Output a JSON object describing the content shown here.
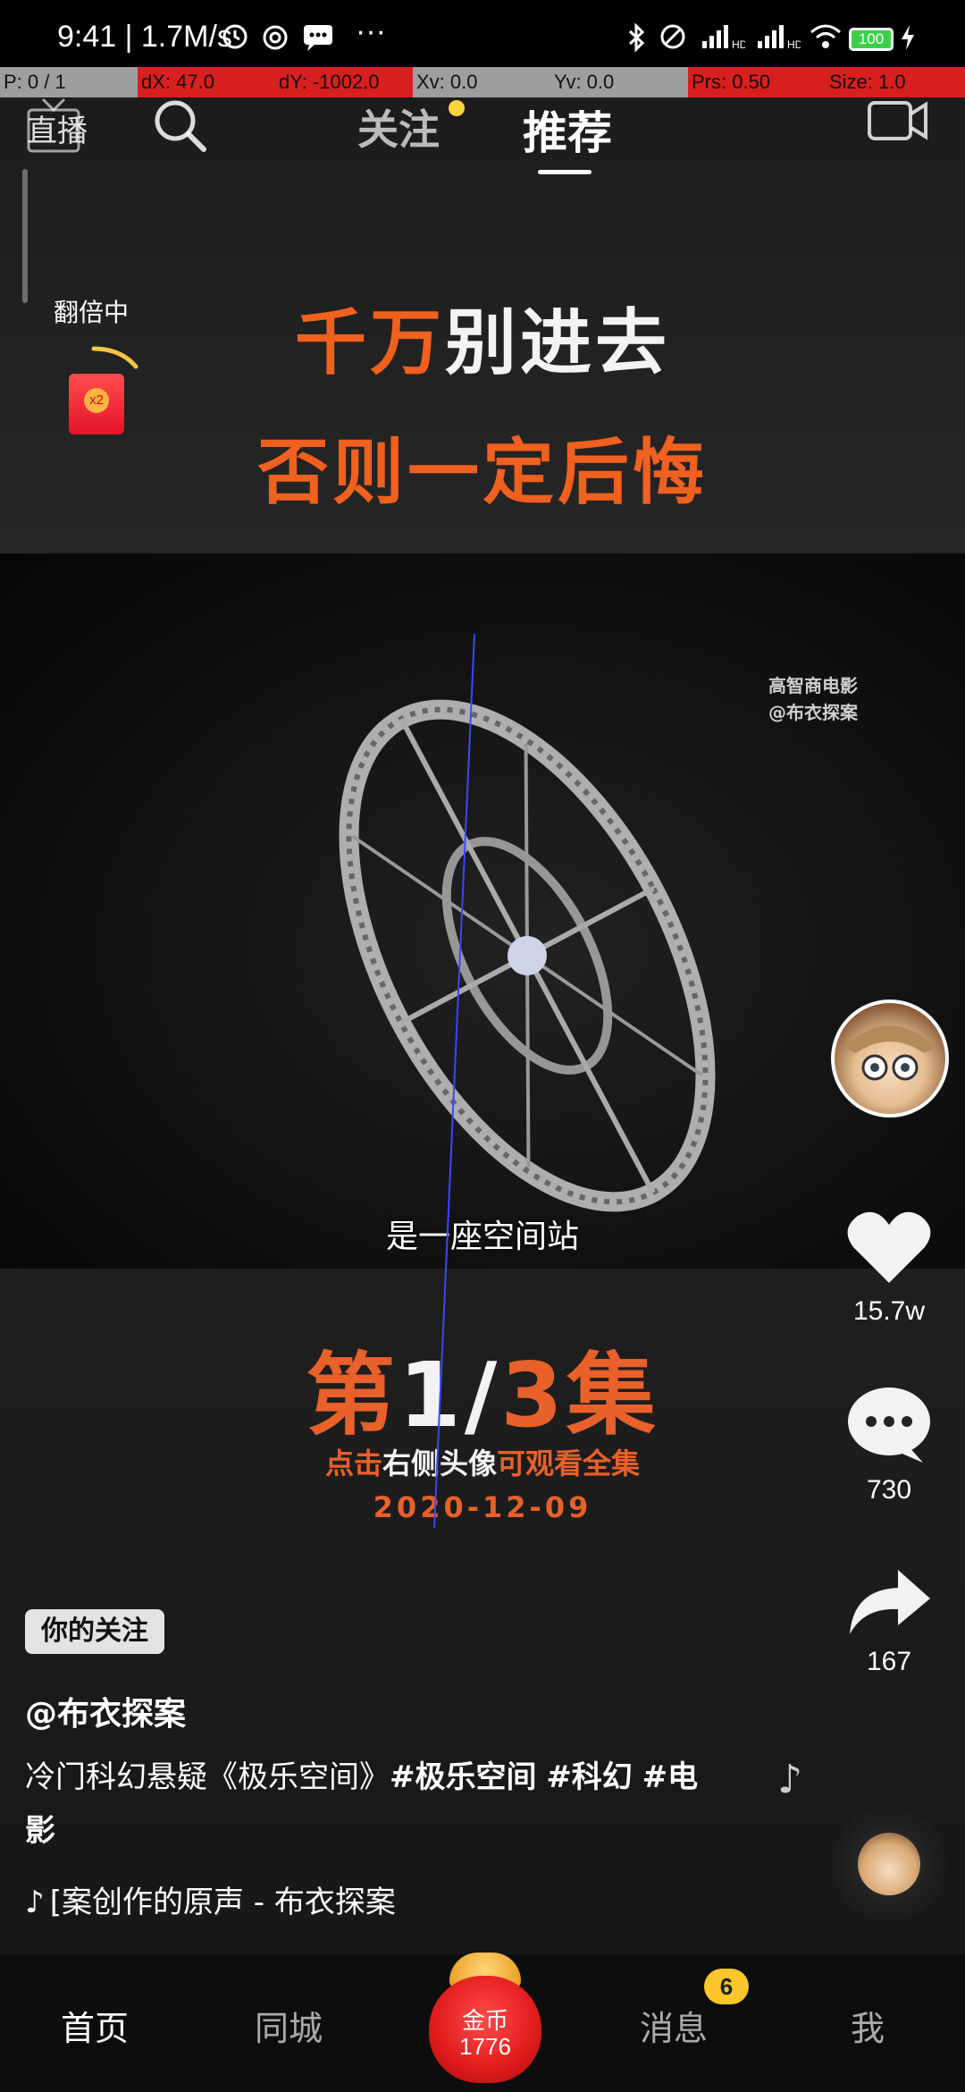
{
  "status_bar": {
    "time_speed": "9:41 | 1.7M/s",
    "battery": "100",
    "dots": "···"
  },
  "debug": {
    "p": "P: 0 / 1",
    "dx": "dX: 47.0",
    "dy": "dY: -1002.0",
    "xv": "Xv: 0.0",
    "yv": "Yv: 0.0",
    "prs": "Prs: 0.50",
    "size": "Size: 1.0"
  },
  "top_nav": {
    "live_label": "直播",
    "tab_follow": "关注",
    "tab_recommend": "推荐"
  },
  "promo": {
    "double_label": "翻倍中",
    "packet_text": "x2"
  },
  "video": {
    "headline_1_a": "千万",
    "headline_1_b": "别进去",
    "headline_2": "否则一定后悔",
    "watermark_1": "高智商电影",
    "watermark_2": "@布衣探案",
    "subtitle": "是一座空间站",
    "episode_a": "第",
    "episode_b": "1/",
    "episode_c": "3集",
    "hint_a": "点击",
    "hint_b": "右侧头像",
    "hint_c": "可观看全集",
    "date": "2020-12-09"
  },
  "rail": {
    "likes": "15.7w",
    "comments": "730",
    "shares": "167"
  },
  "post": {
    "follow_badge": "你的关注",
    "author": "@布衣探案",
    "caption_text": "冷门科幻悬疑《极乐空间》",
    "tag_1": "#极乐空间",
    "tag_2": "#科幻",
    "tag_3": "#电影",
    "music": "[案创作的原声 - 布衣探案"
  },
  "bottom_nav": {
    "home": "首页",
    "local": "同城",
    "coin_label": "金币",
    "coin_count": "1776",
    "messages": "消息",
    "messages_badge": "6",
    "me": "我"
  },
  "colors": {
    "accent_orange": "#f0601f",
    "badge_yellow": "#fdc72c",
    "debug_red": "#d81f1f",
    "debug_gray": "#9e9e9e"
  },
  "icons": [
    "clock-icon",
    "sync-icon",
    "message-icon",
    "bluetooth-icon",
    "signal-icon",
    "wifi-icon",
    "battery-icon",
    "charging-icon",
    "search-icon",
    "camera-icon",
    "heart-icon",
    "comment-icon",
    "share-icon",
    "music-note-icon",
    "tiktok-icon"
  ]
}
